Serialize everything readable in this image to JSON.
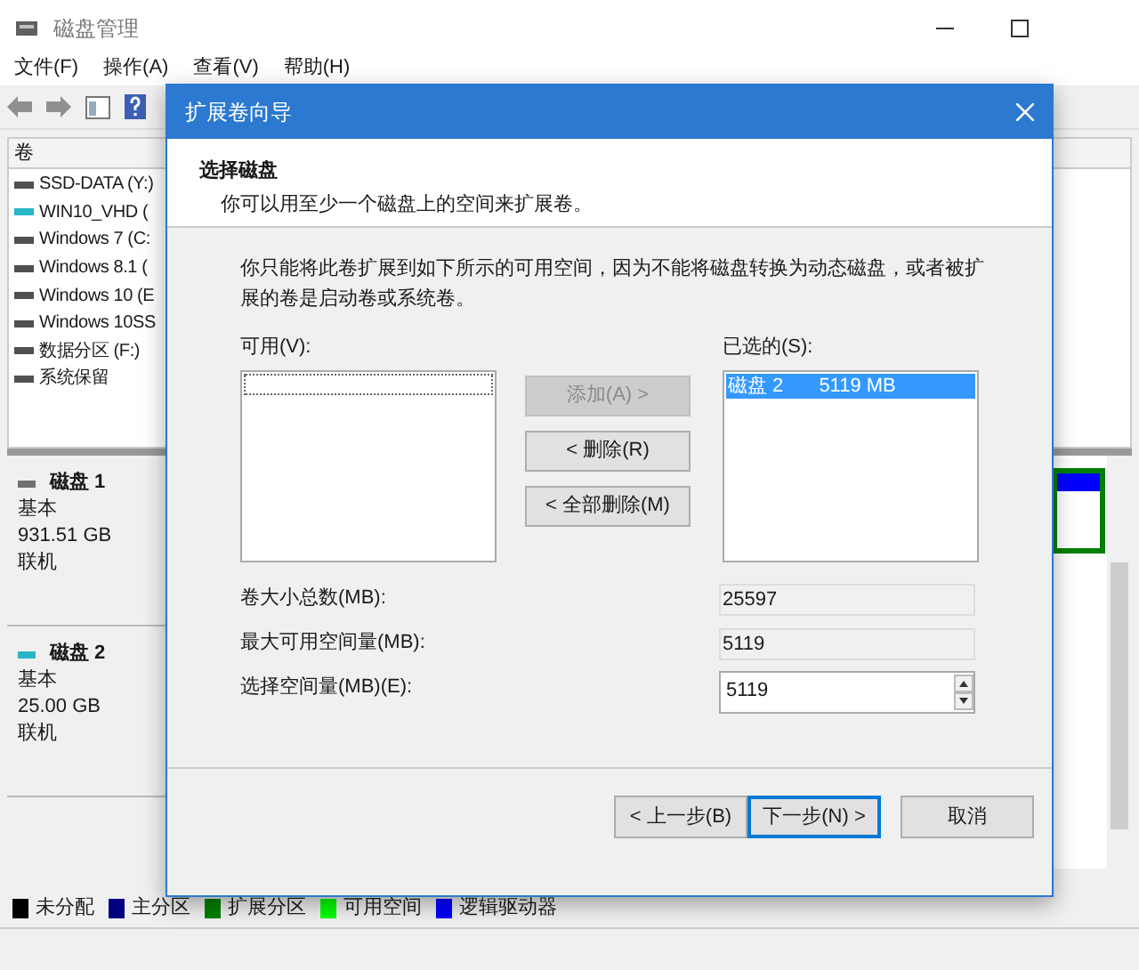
{
  "window": {
    "title": "磁盘管理"
  },
  "menu": [
    "文件(F)",
    "操作(A)",
    "查看(V)",
    "帮助(H)"
  ],
  "volume_list": {
    "column": "卷",
    "items": [
      {
        "name": "SSD-DATA (Y:)",
        "color": "#505050"
      },
      {
        "name": "WIN10_VHD (",
        "color": "#2bb5c8"
      },
      {
        "name": "Windows 7 (C:",
        "color": "#505050"
      },
      {
        "name": "Windows 8.1 (",
        "color": "#505050"
      },
      {
        "name": "Windows 10 (E",
        "color": "#505050"
      },
      {
        "name": "Windows 10SS",
        "color": "#505050"
      },
      {
        "name": "数据分区 (F:)",
        "color": "#505050"
      },
      {
        "name": "系统保留",
        "color": "#505050"
      }
    ]
  },
  "disks": [
    {
      "name": "磁盘 1",
      "type": "基本",
      "size": "931.51 GB",
      "status": "联机",
      "color": "#707070"
    },
    {
      "name": "磁盘 2",
      "type": "基本",
      "size": "25.00 GB",
      "status": "联机",
      "color": "#2bb5c8"
    }
  ],
  "legend": [
    {
      "label": "未分配",
      "color": "#000000"
    },
    {
      "label": "主分区",
      "color": "#000080"
    },
    {
      "label": "扩展分区",
      "color": "#008000"
    },
    {
      "label": "可用空间",
      "color": "#00ff00"
    },
    {
      "label": "逻辑驱动器",
      "color": "#0000ff"
    }
  ],
  "dialog": {
    "title": "扩展卷向导",
    "heading": "选择磁盘",
    "subtitle": "你可以用至少一个磁盘上的空间来扩展卷。",
    "note": "你只能将此卷扩展到如下所示的可用空间，因为不能将磁盘转换为动态磁盘，或者被扩展的卷是启动卷或系统卷。",
    "available_label": "可用(V):",
    "selected_label": "已选的(S):",
    "selected_items": [
      {
        "disk": "磁盘 2",
        "size": "5119 MB",
        "selected": true
      }
    ],
    "move_buttons": [
      {
        "label": "添加(A) >",
        "disabled": true
      },
      {
        "label": "< 删除(R)",
        "disabled": false
      },
      {
        "label": "< 全部删除(M)",
        "disabled": false
      }
    ],
    "fields": [
      {
        "kind": "readonly",
        "label": "卷大小总数(MB):",
        "value": "25597"
      },
      {
        "kind": "readonly",
        "label": "最大可用空间量(MB):",
        "value": "5119"
      },
      {
        "kind": "spin",
        "label": "选择空间量(MB)(E):",
        "value": "5119"
      }
    ],
    "buttons": [
      {
        "label": "< 上一步(B)",
        "focused": false
      },
      {
        "label": "下一步(N) >",
        "focused": true
      },
      {
        "label": "取消",
        "focused": false
      }
    ]
  }
}
